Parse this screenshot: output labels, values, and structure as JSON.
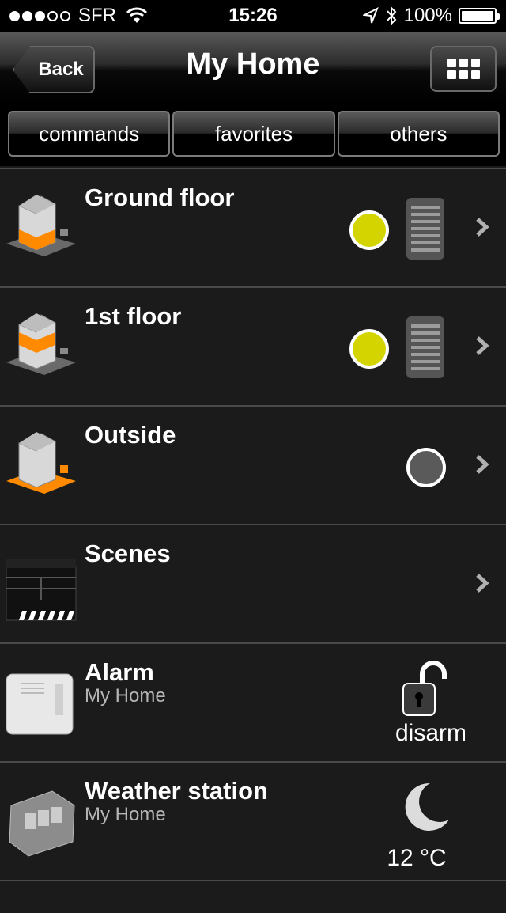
{
  "status_bar": {
    "carrier": "SFR",
    "time": "15:26",
    "battery": "100%"
  },
  "nav": {
    "back_label": "Back",
    "title": "My Home"
  },
  "tabs": [
    {
      "label": "commands"
    },
    {
      "label": "favorites"
    },
    {
      "label": "others"
    }
  ],
  "rows": [
    {
      "title": "Ground floor",
      "icon": "house-ground-floor-icon",
      "status": "on"
    },
    {
      "title": "1st floor",
      "icon": "house-first-floor-icon",
      "status": "on"
    },
    {
      "title": "Outside",
      "icon": "house-outside-icon",
      "status": "off"
    },
    {
      "title": "Scenes",
      "icon": "clapperboard-icon"
    },
    {
      "title": "Alarm",
      "subtitle": "My Home",
      "icon": "alarm-panel-icon",
      "state_label": "disarm"
    },
    {
      "title": "Weather station",
      "subtitle": "My Home",
      "icon": "weather-station-icon",
      "temperature": "12 °C"
    }
  ],
  "colors": {
    "accent_orange": "#ff8a00",
    "status_on": "#d4d400",
    "status_off": "#5a5a5a",
    "background": "#1b1b1b"
  }
}
